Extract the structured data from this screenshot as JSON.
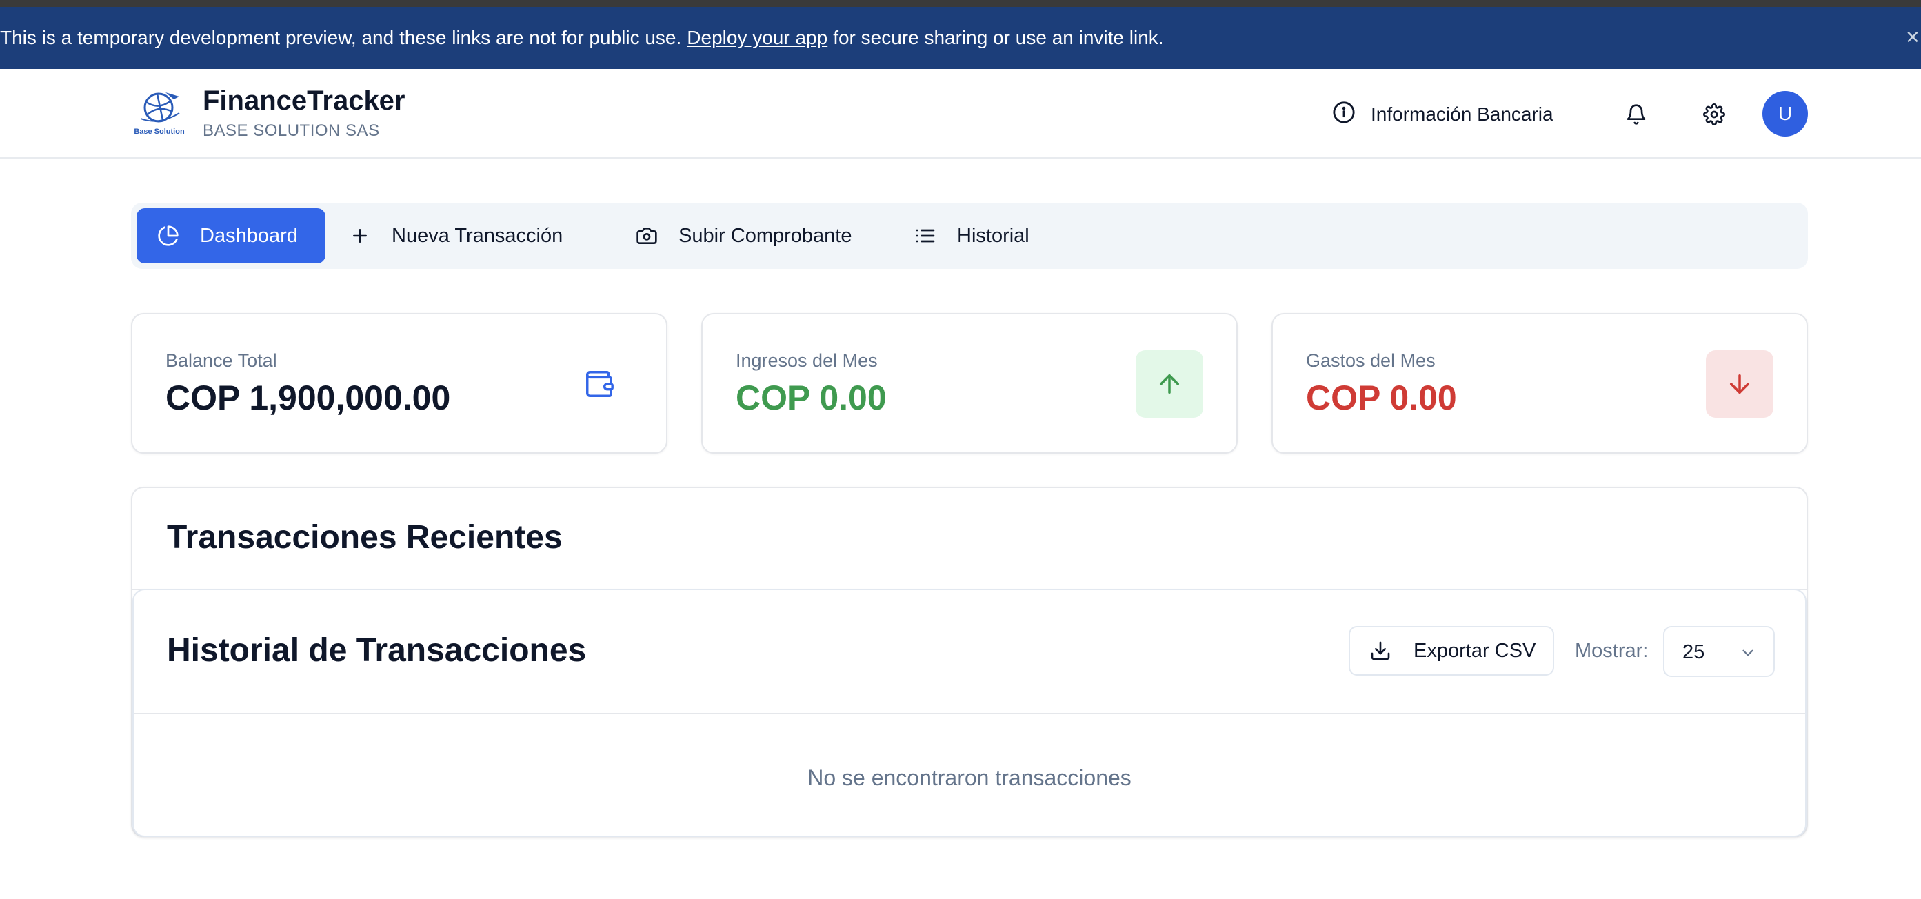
{
  "banner": {
    "text_before": "This is a temporary development preview, and these links are not for public use.",
    "link_text": "Deploy your app",
    "text_after": "for secure sharing or use an invite link.",
    "close_glyph": "×"
  },
  "header": {
    "app_name": "FinanceTracker",
    "company": "BASE SOLUTION SAS",
    "logo_caption": "Base Solution",
    "bank_info_label": "Información Bancaria",
    "avatar_initial": "U",
    "icons": [
      "info-icon",
      "bell-icon",
      "gear-icon"
    ]
  },
  "tabs": [
    {
      "label": "Dashboard",
      "icon": "pie-chart-icon",
      "active": true
    },
    {
      "label": "Nueva Transacción",
      "icon": "plus-icon",
      "active": false
    },
    {
      "label": "Subir Comprobante",
      "icon": "camera-icon",
      "active": false
    },
    {
      "label": "Historial",
      "icon": "list-icon",
      "active": false
    }
  ],
  "cards": [
    {
      "label": "Balance Total",
      "value": "COP 1,900,000.00",
      "icon": "wallet-icon",
      "value_color": "#0f172a"
    },
    {
      "label": "Ingresos del Mes",
      "value": "COP 0.00",
      "icon": "arrow-up-icon",
      "value_color": "#3f9a4f",
      "icon_bg": "#e3f8e8"
    },
    {
      "label": "Gastos del Mes",
      "value": "COP 0.00",
      "icon": "arrow-down-icon",
      "value_color": "#cf3b35",
      "icon_bg": "#f9e3e3"
    }
  ],
  "recent": {
    "title": "Transacciones Recientes"
  },
  "history": {
    "title": "Historial de Transacciones",
    "export_label": "Exportar CSV",
    "show_label": "Mostrar:",
    "page_size": "25",
    "empty_message": "No se encontraron transacciones"
  },
  "colors": {
    "accent": "#3366e8",
    "banner_bg": "#1c3e7a",
    "income": "#3f9a4f",
    "expense": "#cf3b35"
  }
}
